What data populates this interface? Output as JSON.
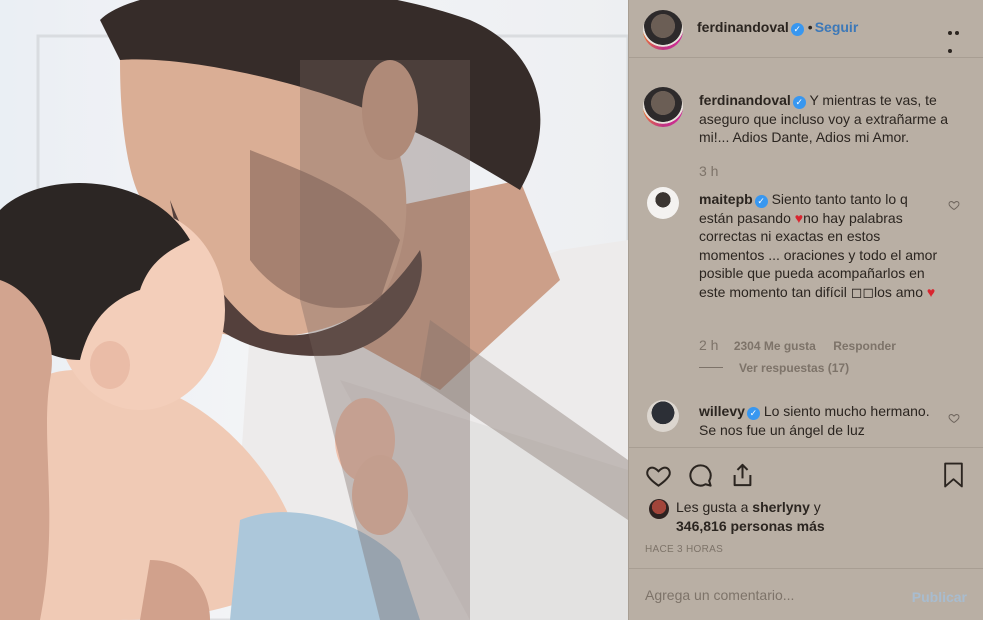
{
  "post": {
    "author": "ferdinandoval",
    "follow_label": "Seguir",
    "dot": "•"
  },
  "caption": {
    "username": "ferdinandoval",
    "text": "Y mientras te vas, te aseguro que incluso voy a extrañarme a mi!... Adios Dante, Adios mi Amor.",
    "time": "3 h"
  },
  "comments": [
    {
      "username": "maitepb",
      "text_a": "Siento tanto tanto lo q están pasando ",
      "heart": "♥",
      "text_b": "no hay palabras correctas ni exactas en estos momentos ... oraciones y todo el amor posible que pueda acompañarlos en este momento tan difícil ◻◻los amo ",
      "heart2": "♥",
      "time": "2 h",
      "likes": "2304 Me gusta",
      "reply_label": "Responder",
      "view_replies": "Ver respuestas (17)"
    },
    {
      "username": "willevy",
      "text": "Lo siento mucho hermano. Se nos fue un ángel de luz"
    }
  ],
  "likes": {
    "prefix": "Les gusta a ",
    "user": "sherlyny",
    "connector": " y",
    "count": "346,816 personas más"
  },
  "timestamp": "HACE 3 HORAS",
  "comment_box": {
    "placeholder": "Agrega un comentario...",
    "publish_label": "Publicar"
  },
  "colors": {
    "panel_bg": "#b9afa4",
    "link_blue": "#3c78b8",
    "verified_blue": "#3897f0",
    "heart_red": "#d9252f"
  }
}
